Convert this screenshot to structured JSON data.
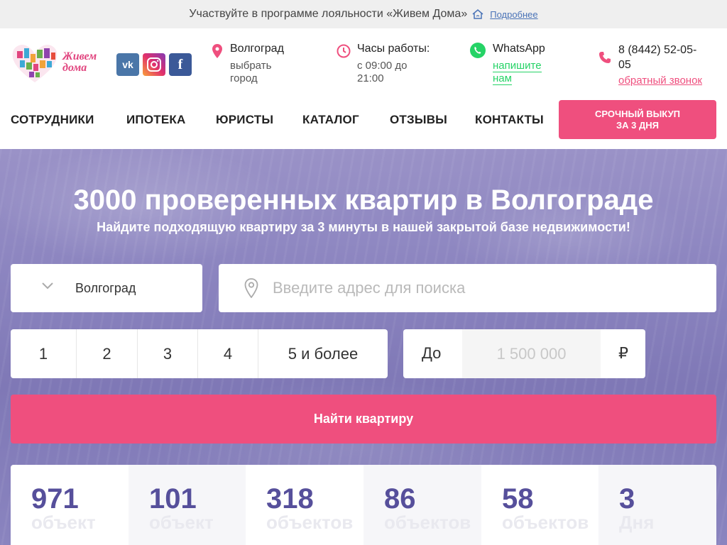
{
  "topbar": {
    "text": "Участвуйте в программе лояльности «Живем Дома»",
    "link": "Подробнее"
  },
  "logo": {
    "line1": "Живем",
    "line2": "дома"
  },
  "social": {
    "vk": "vk",
    "instagram": "instagram-icon",
    "facebook": "f"
  },
  "location": {
    "city": "Волгоград",
    "choose": "выбрать",
    "choose2": "город"
  },
  "hours": {
    "title": "Часы работы:",
    "line1": "с 09:00 до",
    "line2": "21:00"
  },
  "whatsapp": {
    "title": "WhatsApp",
    "link1": "напишите",
    "link2": "нам"
  },
  "phone": {
    "line1": "8 (8442) 52-05-",
    "line2": "05",
    "callback": "обратный звонок"
  },
  "nav": [
    "СОТРУДНИКИ",
    "ИПОТЕКА",
    "ЮРИСТЫ",
    "КАТАЛОГ",
    "ОТЗЫВЫ",
    "КОНТАКТЫ"
  ],
  "cta": {
    "line1": "СРОЧНЫЙ ВЫКУП",
    "line2": "ЗА 3 ДНЯ"
  },
  "hero": {
    "title": "3000 проверенных квартир в Волгограде",
    "subtitle": "Найдите подходящую квартиру за 3 минуты в нашей закрытой базе недвижимости!"
  },
  "search": {
    "city": "Волгоград",
    "address_placeholder": "Введите адрес для поиска",
    "rooms": [
      "1",
      "2",
      "3",
      "4",
      "5 и более"
    ],
    "price_label": "До",
    "price_placeholder": "1 500 000",
    "currency": "₽",
    "submit": "Найти квартиру"
  },
  "stats": [
    {
      "value": "971",
      "unit": "объект"
    },
    {
      "value": "101",
      "unit": "объект"
    },
    {
      "value": "318",
      "unit": "объектов"
    },
    {
      "value": "86",
      "unit": "объектов"
    },
    {
      "value": "58",
      "unit": "объектов"
    },
    {
      "value": "3",
      "unit": "Дня"
    }
  ],
  "colors": {
    "accent": "#ef4f7e",
    "stat_number": "#564f9b",
    "link": "#4a73b7",
    "whatsapp": "#25d366"
  }
}
